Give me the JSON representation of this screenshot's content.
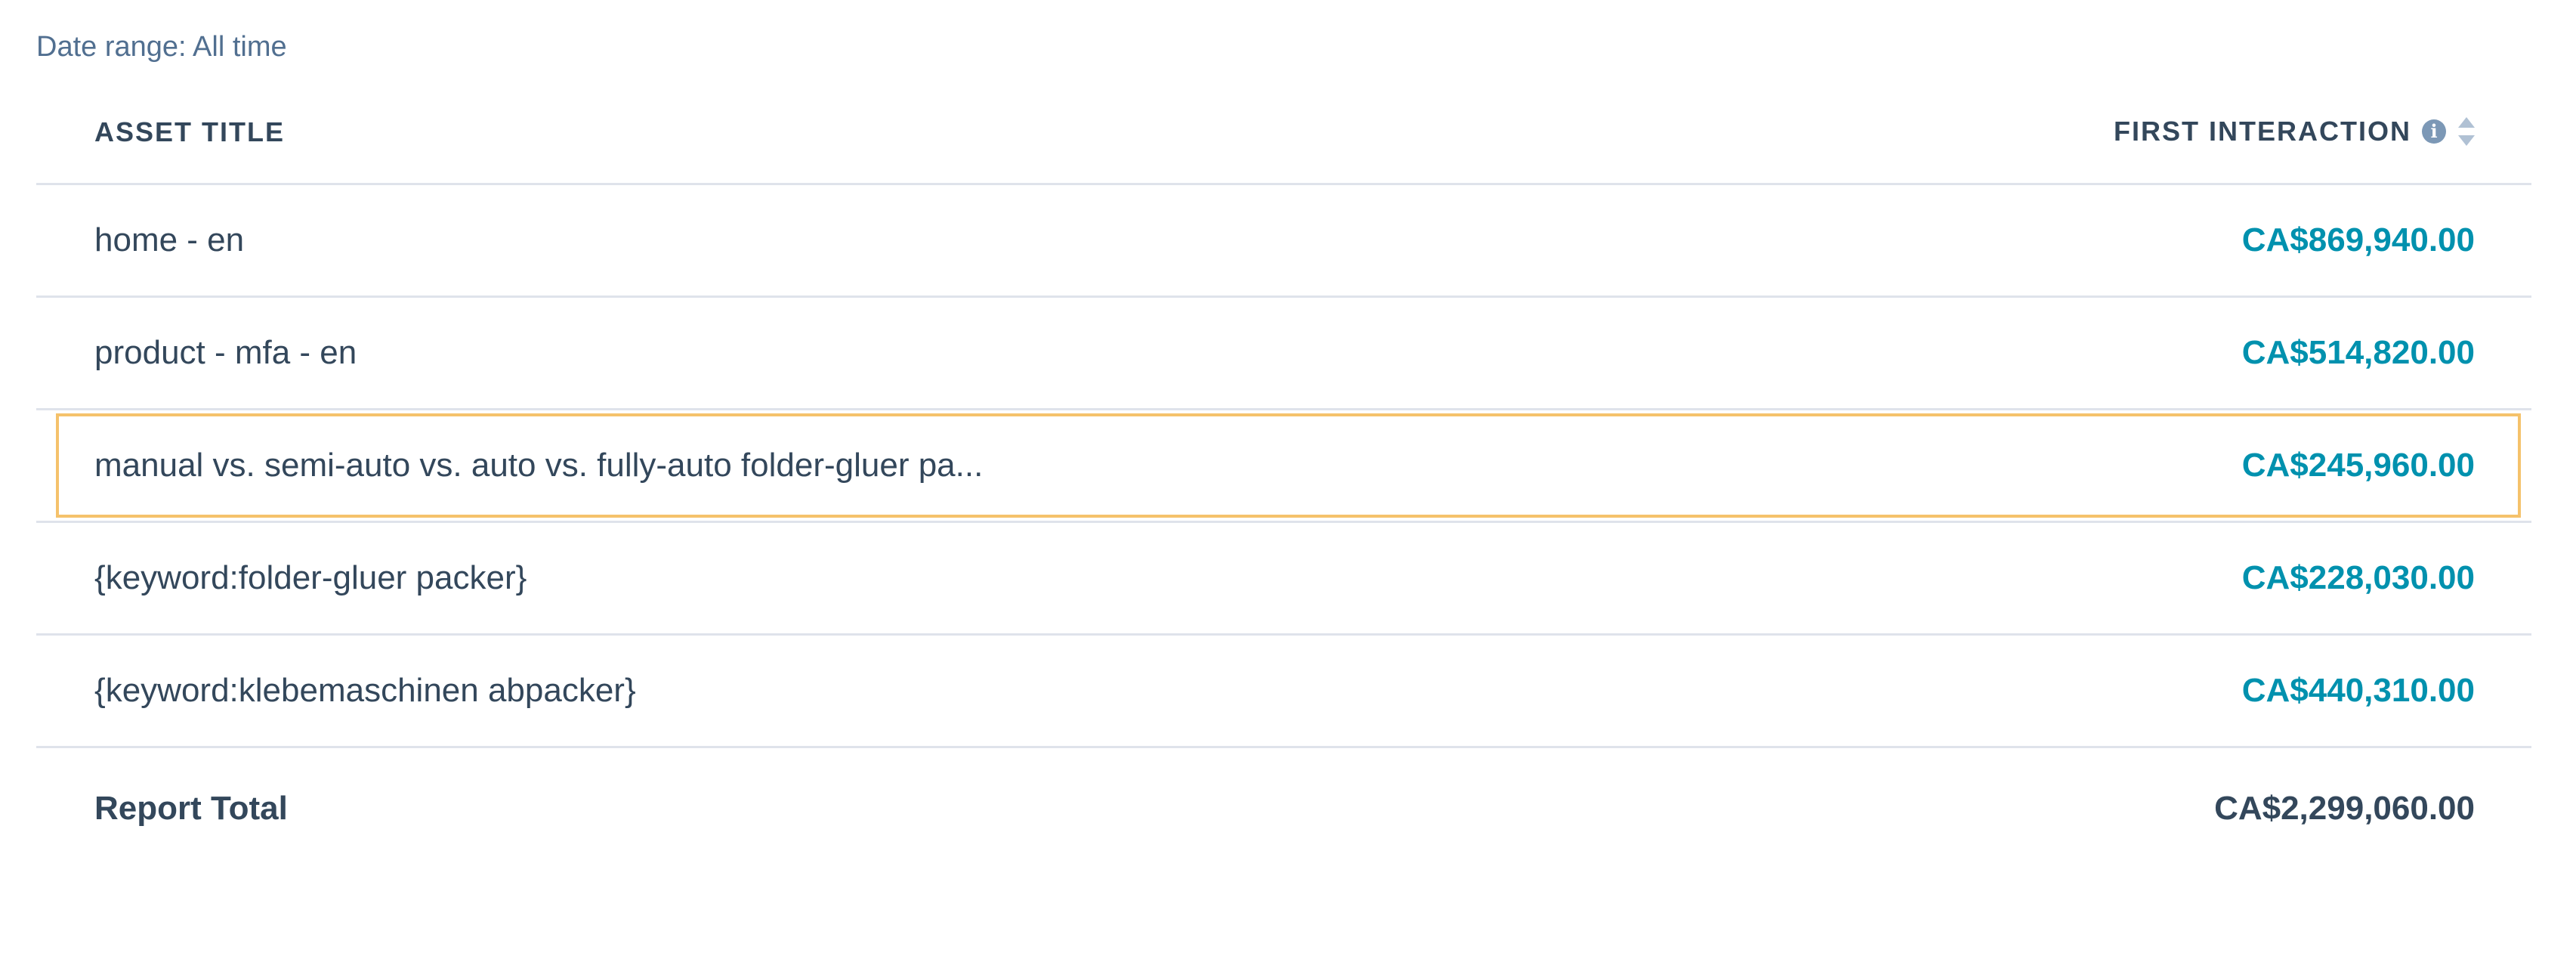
{
  "date_range": "Date range: All time",
  "table": {
    "headers": {
      "title": "ASSET TITLE",
      "metric": "FIRST INTERACTION"
    },
    "rows": [
      {
        "title": "home - en",
        "value": "CA$869,940.00"
      },
      {
        "title": "product - mfa - en",
        "value": "CA$514,820.00"
      },
      {
        "title": "manual vs. semi-auto vs. auto vs. fully-auto folder-gluer pa...",
        "value": "CA$245,960.00"
      },
      {
        "title": "{keyword:folder-gluer packer}",
        "value": "CA$228,030.00"
      },
      {
        "title": "{keyword:klebemaschinen abpacker}",
        "value": "CA$440,310.00"
      }
    ],
    "total": {
      "label": "Report Total",
      "value": "CA$2,299,060.00"
    }
  },
  "icons": {
    "info": "info-icon",
    "sort": "sort-icon"
  },
  "colors": {
    "link_value": "#0091ae",
    "text": "#33475b",
    "highlight_border": "#f5c26b",
    "divider": "#dfe3eb"
  }
}
